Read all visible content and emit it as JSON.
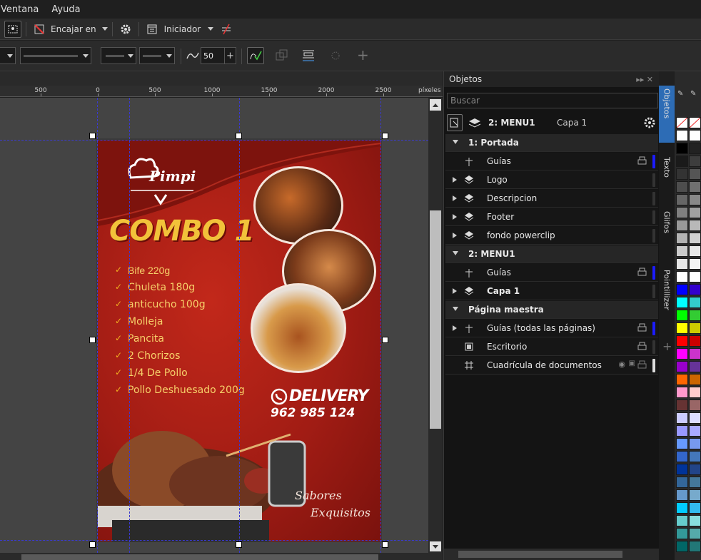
{
  "menu": {
    "items": [
      "Ventana",
      "Ayuda"
    ]
  },
  "toolbar": {
    "snap_label": "Encajar en",
    "launcher_label": "Iniciador",
    "smoothing_value": "50"
  },
  "ruler": {
    "ticks": [
      "500",
      "0",
      "500",
      "1000",
      "1500",
      "2000",
      "2500"
    ],
    "unit": "píxeles"
  },
  "poster": {
    "brand": "Pimpi",
    "title": "COMBO 1",
    "items": [
      "Bife 220g",
      "Chuleta 180g",
      "anticucho 100g",
      "Molleja",
      "Pancita",
      "2 Chorizos",
      "1/4 De Pollo",
      "Pollo Deshuesado 200g"
    ],
    "delivery_label": "DELIVERY",
    "phone": "962 985 124",
    "slogan_line1": "Sabores",
    "slogan_line2": "Exquisitos"
  },
  "objects_panel": {
    "title": "Objetos",
    "search_placeholder": "Buscar",
    "current_page": "2: MENU1",
    "current_layer": "Capa 1",
    "rows": [
      {
        "label": "1: Portada",
        "type": "page",
        "expanded": true
      },
      {
        "label": "Guías",
        "type": "guides",
        "color": "#1c1cff"
      },
      {
        "label": "Logo",
        "type": "layer"
      },
      {
        "label": "Descripcion",
        "type": "layer"
      },
      {
        "label": "Footer",
        "type": "layer"
      },
      {
        "label": "fondo powerclip",
        "type": "layer"
      },
      {
        "label": "2: MENU1",
        "type": "page",
        "expanded": true
      },
      {
        "label": "Guías",
        "type": "guides",
        "color": "#1c1cff"
      },
      {
        "label": "Capa 1",
        "type": "layer",
        "bold": true
      },
      {
        "label": "Página maestra",
        "type": "page",
        "expanded": true
      },
      {
        "label": "Guías (todas las páginas)",
        "type": "guides",
        "color": "#1c1cff"
      },
      {
        "label": "Escritorio",
        "type": "desktop"
      },
      {
        "label": "Cuadrícula de documentos",
        "type": "grid"
      }
    ]
  },
  "side_tabs": [
    "Objetos",
    "Texto",
    "Glifos",
    "Pointillizer"
  ],
  "palette": {
    "col1": [
      "#ffffff",
      "#000000",
      "#1a1a1a",
      "#333333",
      "#4d4d4d",
      "#666666",
      "#808080",
      "#999999",
      "#b3b3b3",
      "#cccccc",
      "#e6e6e6",
      "#ffffff",
      "#0000ff",
      "#00ffff",
      "#00ff00",
      "#ffff00",
      "#ff0000",
      "#ff00ff",
      "#9900cc",
      "#ff6600",
      "#ff99cc",
      "#663333",
      "#ccccff",
      "#9999ff",
      "#6699ff",
      "#3366cc",
      "#003399",
      "#336699",
      "#6699cc",
      "#00ccff",
      "#66cccc",
      "#339999",
      "#006666"
    ],
    "col2": [
      "#ffffff",
      "#222222",
      "#3d3d3d",
      "#555555",
      "#707070",
      "#888888",
      "#a0a0a0",
      "#b8b8b8",
      "#d0d0d0",
      "#e8e8e8",
      "#f4f4f4",
      "#ffffff",
      "#3300cc",
      "#33cccc",
      "#33cc33",
      "#cccc00",
      "#cc0000",
      "#cc33cc",
      "#663399",
      "#cc6600",
      "#ffcccc",
      "#996666",
      "#ddddff",
      "#aaaaff",
      "#7799ee",
      "#4477bb",
      "#224488",
      "#447799",
      "#77aacc",
      "#33bbee",
      "#88dddd",
      "#55aaaa",
      "#227777"
    ]
  }
}
